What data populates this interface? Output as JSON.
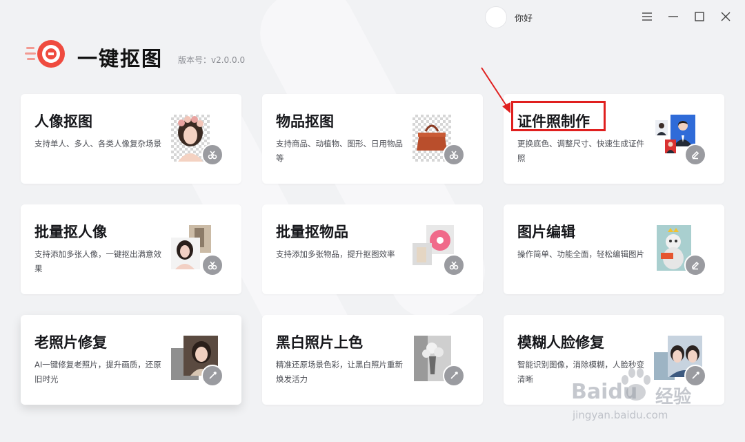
{
  "header": {
    "user_name": "你好",
    "app_title": "一键抠图",
    "version": "版本号：v2.0.0.0"
  },
  "cards": [
    {
      "title": "人像抠图",
      "desc": "支持单人、多人、各类人像复杂场景"
    },
    {
      "title": "物品抠图",
      "desc": "支持商品、动植物、图形、日用物品等"
    },
    {
      "title": "证件照制作",
      "desc": "更换底色、调整尺寸、快速生成证件照"
    },
    {
      "title": "批量抠人像",
      "desc": "支持添加多张人像，一键抠出满意效果"
    },
    {
      "title": "批量抠物品",
      "desc": "支持添加多张物品，提升抠图效率"
    },
    {
      "title": "图片编辑",
      "desc": "操作简单、功能全面，轻松编辑图片"
    },
    {
      "title": "老照片修复",
      "desc": "AI一键修复老照片，提升画质，还原旧时光"
    },
    {
      "title": "黑白照片上色",
      "desc": "精准还原场景色彩，让黑白照片重新焕发活力"
    },
    {
      "title": "模糊人脸修复",
      "desc": "智能识别图像，消除模糊，人脸秒变清晰"
    }
  ],
  "watermark": {
    "brand": "Baidu",
    "suffix": "经验",
    "url": "jingyan.baidu.com"
  },
  "colors": {
    "accent_red": "#e0201f",
    "logo_red": "#ef4b3f",
    "badge_gray": "#9a9ba0"
  }
}
